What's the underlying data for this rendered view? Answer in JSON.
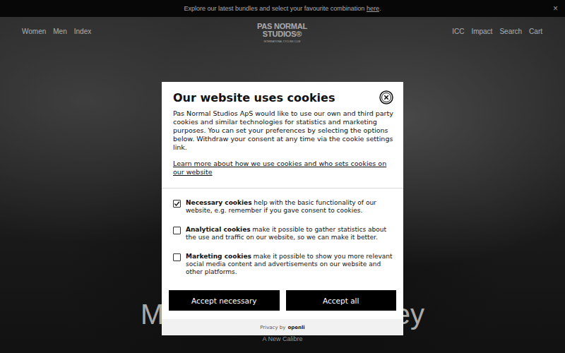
{
  "announcement": {
    "text": "Explore our latest bundles and select your favourite combination",
    "link": "here",
    "suffix": ".",
    "close": "×"
  },
  "nav_left": [
    "Women",
    "Men",
    "Index"
  ],
  "logo": {
    "line1": "PAS NORMAL",
    "line2": "STUDIOS®",
    "tagline": "INTERNATIONAL CYCLING CLUB"
  },
  "nav_right": [
    "ICC",
    "Impact",
    "Search",
    "Cart"
  ],
  "hero": {
    "title_start": "M",
    "title_end": "ey",
    "subtitle": "A New Calibre"
  },
  "cookie_dialog": {
    "title": "Our website uses cookies",
    "description": "Pas Normal Studios ApS would like to use our own and third party cookies and similar technologies for statistics and marketing purposes. You can set your preferences by selecting the options below. Withdraw your consent at any time via the cookie settings link.",
    "link": "Learn more about how we use cookies and who sets cookies on our website",
    "options": [
      {
        "label": "Necessary cookies",
        "description": "help with the basic functionality of our website, e.g. remember if you gave consent to cookies.",
        "checked": true
      },
      {
        "label": "Analytical cookies",
        "description": "make it possible to gather statistics about the use and traffic on our website, so we can make it better.",
        "checked": false
      },
      {
        "label": "Marketing cookies",
        "description": "make it possible to show you more relevant social media content and advertisements on our website and other platforms.",
        "checked": false
      }
    ],
    "buttons": [
      "Accept necessary",
      "Accept all"
    ],
    "footer": {
      "text": "Privacy by",
      "brand": "openli"
    }
  }
}
